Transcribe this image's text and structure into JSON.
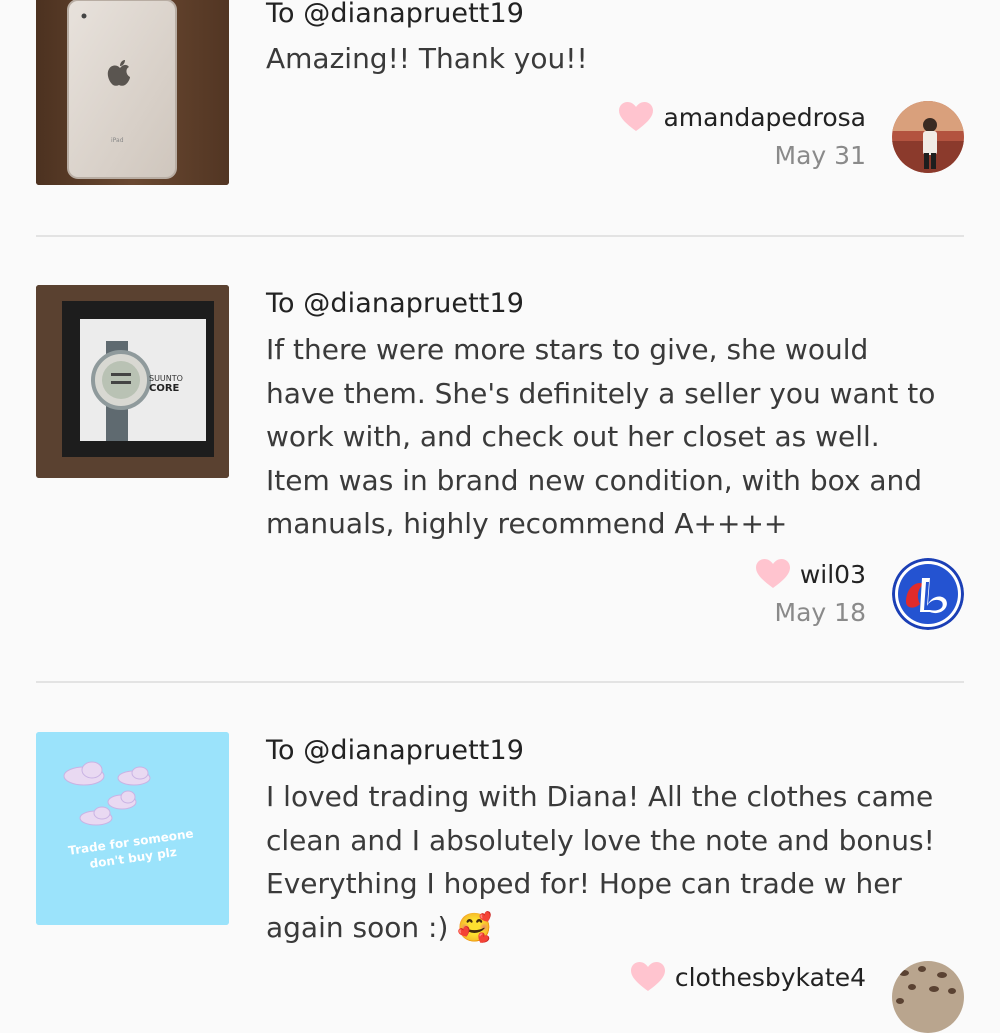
{
  "reviews": [
    {
      "to": "To @dianapruett19",
      "message": "Amazing!! Thank you!!",
      "username": "amandapedrosa",
      "date": "May 31",
      "thumb_icon": "ipad-photo",
      "avatar_icon": "user-photo"
    },
    {
      "to": "To @dianapruett19",
      "message_lines": [
        "If there were more stars to give, she would",
        "have them. She's definitely a seller you want to",
        "work with, and check out her closet as well.",
        "Item was in brand new condition, with box and",
        "manuals, highly recommend A++++"
      ],
      "username": "wil03",
      "date": "May 18",
      "thumb_text_1": "SUUNTO",
      "thumb_text_2": "CORE",
      "thumb_icon": "watch-photo",
      "avatar_icon": "expos-logo"
    },
    {
      "to": "To @dianapruett19",
      "message_lines": [
        "I loved trading with Diana! All the clothes came",
        "clean and I absolutely love the note and bonus!",
        "Everything I hoped for! Hope can trade w her",
        "again soon :) 🥰"
      ],
      "username": "clothesbykate4",
      "thumb_text_1": "Trade for someone",
      "thumb_text_2": "don't buy plz",
      "thumb_icon": "clouds-graphic",
      "avatar_icon": "leopard-photo"
    }
  ],
  "colors": {
    "heart": "#ffc4cf",
    "divider": "#e3e3e3",
    "date": "#8a8a8a",
    "thumb3_bg": "#9be3fb"
  }
}
